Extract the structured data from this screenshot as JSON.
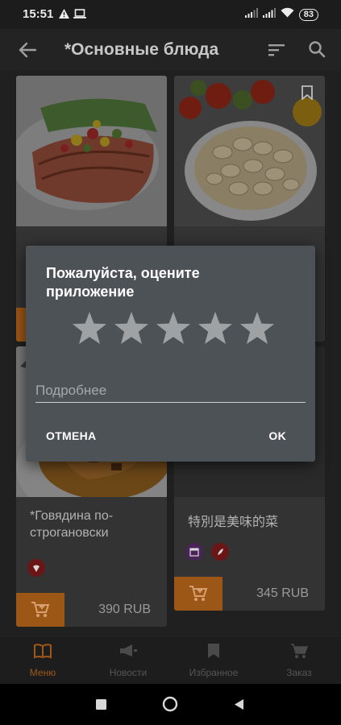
{
  "status_bar": {
    "time": "15:51",
    "battery": "83",
    "icons": [
      "warning-icon",
      "laptop-icon",
      "signal-icon",
      "signal-icon",
      "wifi-icon",
      "battery-icon"
    ]
  },
  "app_bar": {
    "title": "*Основные блюда",
    "icons": [
      "back-arrow-icon",
      "sort-icon",
      "search-icon"
    ]
  },
  "cards": [
    {
      "name": "",
      "price": ""
    },
    {
      "name": "",
      "price": ""
    },
    {
      "name": "*Говядина по-строгановски",
      "price": "390 RUB"
    },
    {
      "name": "特別是美味的菜",
      "price": "345 RUB"
    }
  ],
  "rating_dialog": {
    "title": "Пожалуйста, оцените приложение",
    "star_count": 5,
    "rating": 0,
    "input_placeholder": "Подробнее",
    "input_value": "",
    "cancel_label": "ОТМЕНА",
    "ok_label": "OK"
  },
  "bottom_nav": {
    "items": [
      {
        "label": "Меню",
        "icon": "book-icon",
        "active": true
      },
      {
        "label": "Новости",
        "icon": "megaphone-icon",
        "active": false
      },
      {
        "label": "Избранное",
        "icon": "bookmark-icon",
        "active": false
      },
      {
        "label": "Заказ",
        "icon": "cart-icon",
        "active": false
      }
    ]
  },
  "colors": {
    "accent": "#f08a24",
    "dialog_background": "#4d5256",
    "star": "#9ea2a5"
  }
}
